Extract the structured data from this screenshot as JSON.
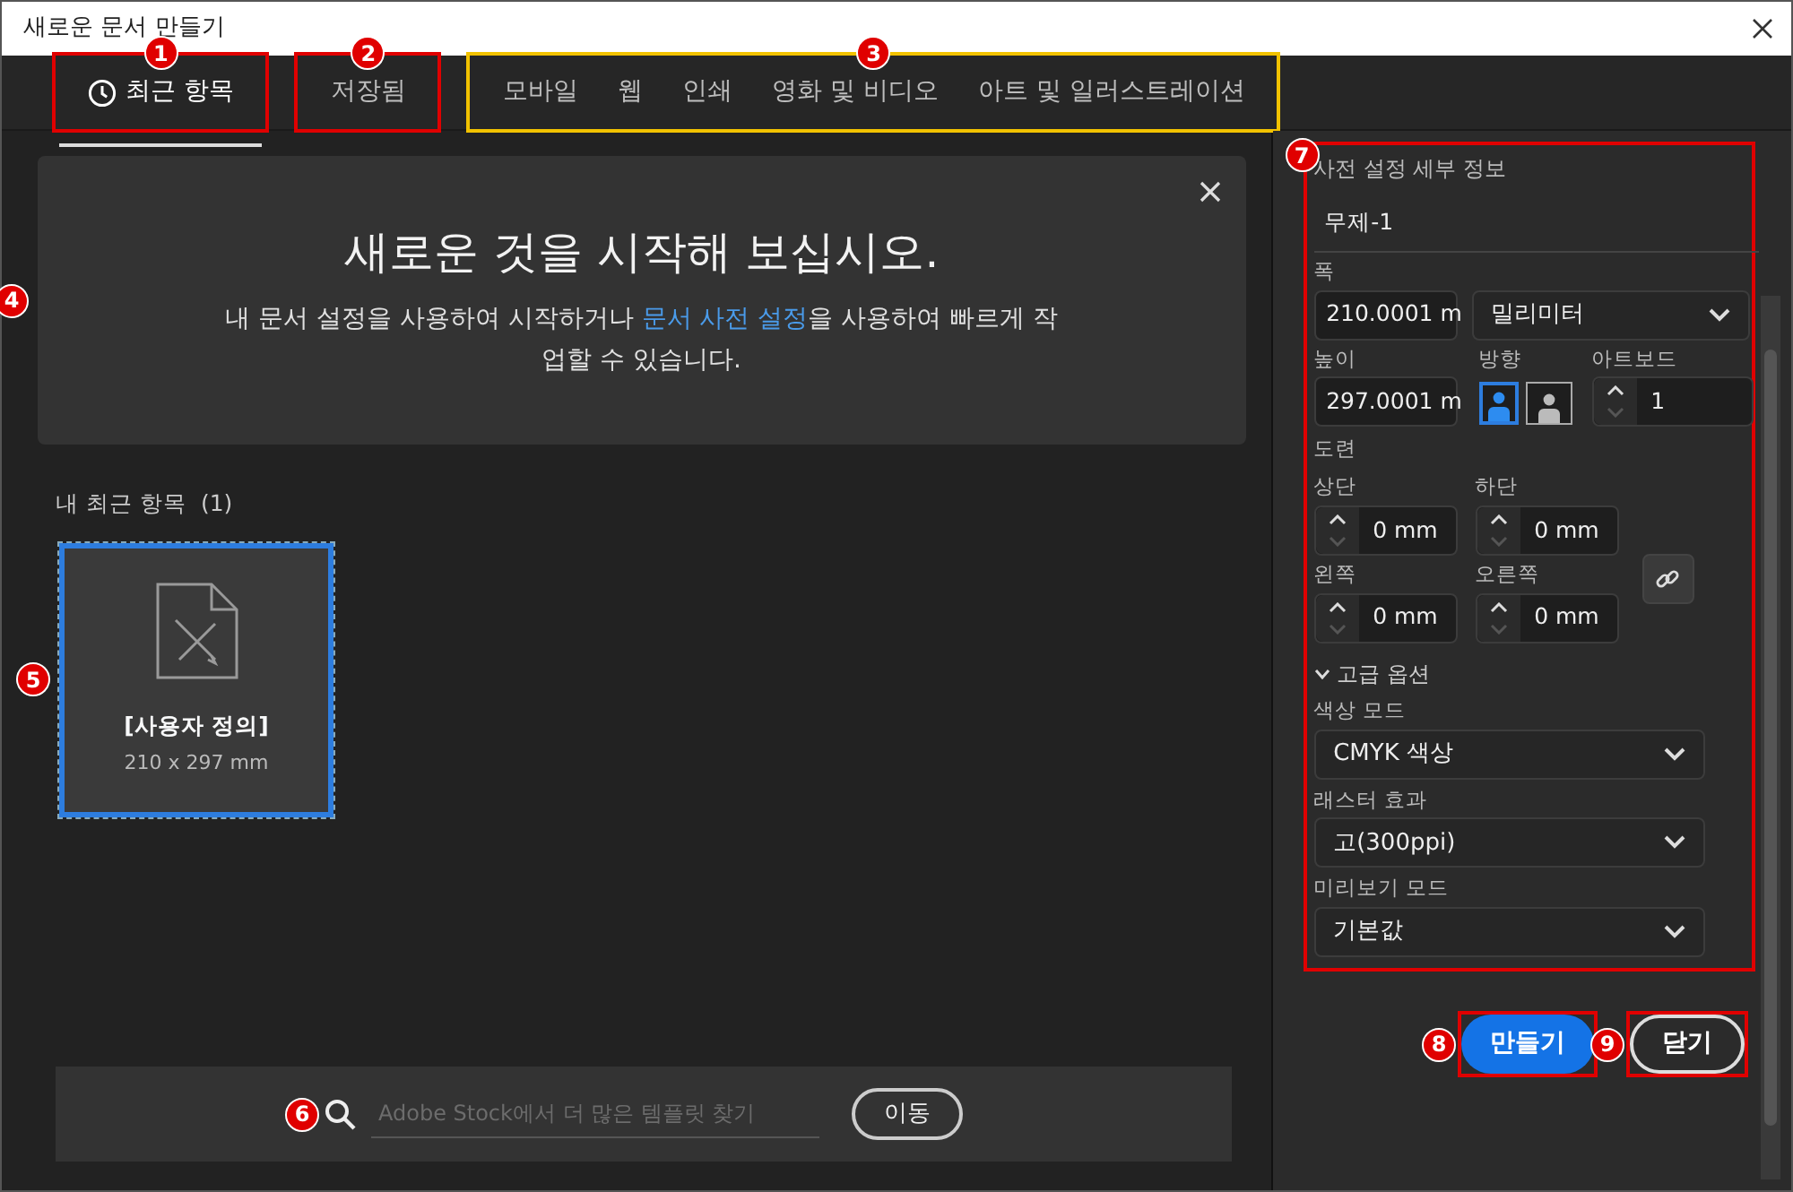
{
  "window": {
    "title": "새로운 문서 만들기"
  },
  "tab_groups": [
    {
      "marker": {
        "number": "1",
        "color": "#e00000"
      },
      "tabs": [
        {
          "label": "최근 항목",
          "kind": "with-icon",
          "selected": true
        }
      ]
    },
    {
      "marker": {
        "number": "2",
        "color": "#e00000"
      },
      "tabs": [
        {
          "label": "저장됨",
          "kind": "plain",
          "selected": false
        }
      ]
    },
    {
      "marker": {
        "number": "3",
        "color": "#f2c200"
      },
      "tabs": [
        {
          "label": "모바일",
          "kind": "plain",
          "selected": false
        },
        {
          "label": "웹",
          "kind": "plain",
          "selected": false
        },
        {
          "label": "인쇄",
          "kind": "plain",
          "selected": false
        },
        {
          "label": "영화 및 비디오",
          "kind": "plain",
          "selected": false
        },
        {
          "label": "아트 및 일러스트레이션",
          "kind": "plain",
          "selected": false
        }
      ]
    }
  ],
  "banner": {
    "marker": {
      "number": "4"
    },
    "title": "새로운 것을 시작해 보십시오.",
    "text_before": "내 문서 설정을 사용하여 시작하거나 ",
    "link": "문서 사전 설정",
    "text_after": "을 사용하여 빠르게 작업할 수 있습니다."
  },
  "recent": {
    "heading": "내 최근 항목",
    "count": "(1)",
    "items": [
      {
        "name": "[사용자 정의]",
        "size": "210 x 297 mm",
        "selected": true,
        "marker": {
          "number": "5"
        }
      }
    ]
  },
  "search": {
    "marker": {
      "number": "6"
    },
    "placeholder": "Adobe Stock에서 더 많은 템플릿 찾기",
    "button": "이동"
  },
  "preset": {
    "marker": {
      "number": "7",
      "color": "#e00000"
    },
    "title": "사전 설정 세부 정보",
    "name": "무제-1",
    "width": {
      "label": "폭",
      "value": "210.0001 m"
    },
    "units": "밀리미터",
    "height": {
      "label": "높이",
      "value": "297.0001 m"
    },
    "orientation": {
      "label": "방향",
      "options": [
        {
          "kind": "portrait",
          "selected": true
        },
        {
          "kind": "landscape",
          "selected": false
        }
      ]
    },
    "artboards": {
      "label": "아트보드",
      "value": "1"
    },
    "bleed": {
      "label": "도련",
      "fields": [
        {
          "label": "상단",
          "value": "0 mm"
        },
        {
          "label": "하단",
          "value": "0 mm"
        },
        {
          "label": "왼쪽",
          "value": "0 mm"
        },
        {
          "label": "오른쪽",
          "value": "0 mm"
        }
      ]
    },
    "advanced": {
      "label": "고급 옵션",
      "expanded": true
    },
    "selects": [
      {
        "label": "색상 모드",
        "value": "CMYK 색상"
      },
      {
        "label": "래스터 효과",
        "value": "고(300ppi)"
      },
      {
        "label": "미리보기 모드",
        "value": "기본값"
      }
    ]
  },
  "buttons": [
    {
      "label": "만들기",
      "kind": "primary",
      "marker": {
        "number": "8",
        "color": "#e00000"
      }
    },
    {
      "label": "닫기",
      "kind": "secondary",
      "marker": {
        "number": "9",
        "color": "#e00000"
      }
    }
  ]
}
